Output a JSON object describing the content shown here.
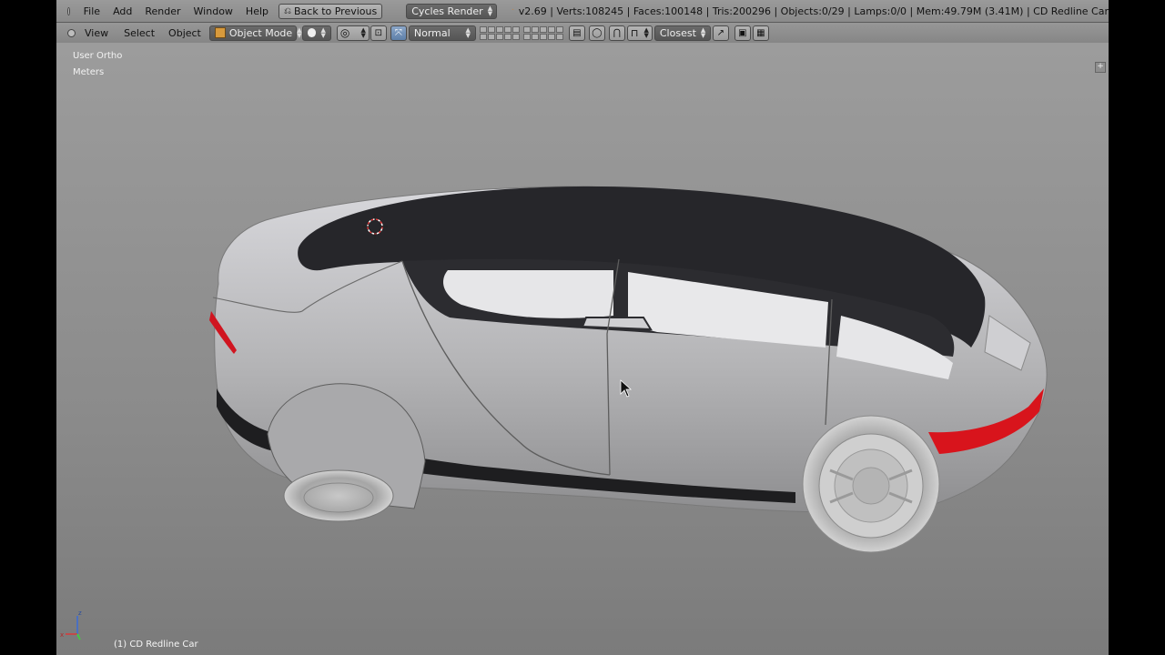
{
  "header_menu": [
    "File",
    "Add",
    "Render",
    "Window",
    "Help"
  ],
  "back_button_label": "Back to Previous",
  "render_engine": "Cycles Render",
  "stats": "v2.69 | Verts:108245 | Faces:100148 | Tris:200296 | Objects:0/29 | Lamps:0/0 | Mem:49.79M (3.41M) | CD Redline Car",
  "view_menu": [
    "View",
    "Select",
    "Object"
  ],
  "mode": "Object Mode",
  "transform_orientation": "Normal",
  "snap_target": "Closest",
  "viewport": {
    "view_label": "User Ortho",
    "units_label": "Meters",
    "object_label": "(1) CD Redline Car",
    "axis_labels": {
      "z": "z",
      "x": "x"
    }
  },
  "icons": [
    "blender-logo-icon",
    "back-arrow-icon",
    "object-mode-cube-icon",
    "viewport-shading-icon",
    "pivot-icon",
    "manipulator-icon",
    "layers-icon",
    "magnet-snap-icon",
    "render-preview-icon",
    "cursor-icon",
    "3d-cursor-icon"
  ]
}
